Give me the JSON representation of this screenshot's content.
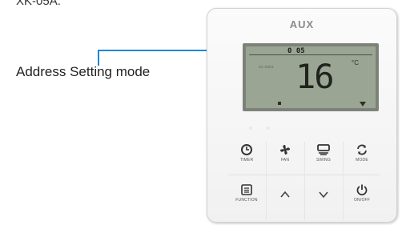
{
  "caption_top": "XK-05A.",
  "callout": {
    "label": "Address Setting mode",
    "line_color": "#1e88d8"
  },
  "panel": {
    "brand": "AUX",
    "lcd": {
      "address_code": "0 05",
      "temperature": "16",
      "unit": "°C"
    },
    "buttons": {
      "timer": {
        "label": "TIMER",
        "icon": "clock-icon"
      },
      "fan": {
        "label": "FAN",
        "icon": "fan-icon"
      },
      "swing": {
        "label": "SWING",
        "icon": "swing-icon"
      },
      "mode": {
        "label": "MODE",
        "icon": "cycle-icon"
      },
      "function": {
        "label": "FUNCTION",
        "icon": "menu-icon"
      },
      "up": {
        "icon": "chevron-up-icon"
      },
      "down": {
        "icon": "chevron-down-icon"
      },
      "onoff": {
        "label": "ON/OFF",
        "icon": "power-icon"
      }
    }
  }
}
